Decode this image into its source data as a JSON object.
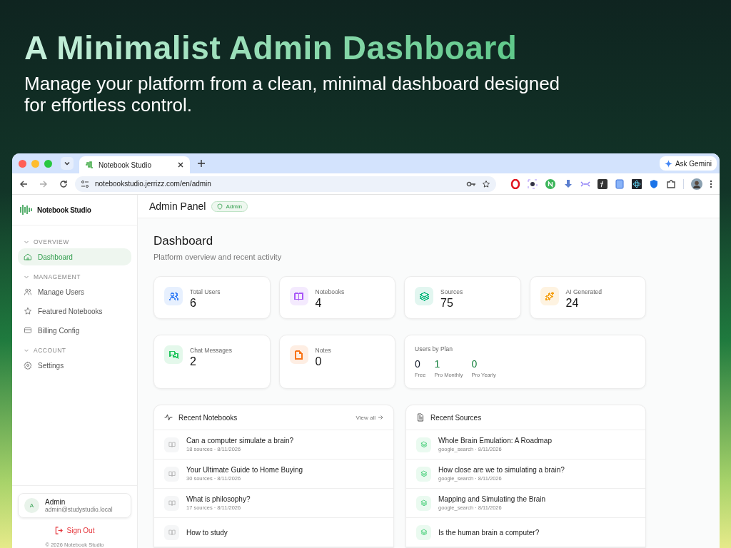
{
  "promo": {
    "headline": "A Minimalist Admin Dashboard",
    "subheadline": "Manage your platform from a clean, minimal dashboard designed for effortless control."
  },
  "browser": {
    "tab_title": "Notebook Studio",
    "url": "notebookstudio.jerrizz.com/en/admin",
    "ask_button": "Ask Gemini"
  },
  "sidebar": {
    "brand": "Notebook Studio",
    "sections": [
      {
        "title": "OVERVIEW",
        "expanded": true,
        "items": [
          {
            "label": "Dashboard",
            "kind": "home",
            "selected": true
          }
        ]
      },
      {
        "title": "MANAGEMENT",
        "expanded": true,
        "items": [
          {
            "label": "Manage Users",
            "kind": "users",
            "selected": false
          },
          {
            "label": "Featured Notebooks",
            "kind": "star",
            "selected": false
          },
          {
            "label": "Billing Config",
            "kind": "card",
            "selected": false
          }
        ]
      },
      {
        "title": "ACCOUNT",
        "expanded": true,
        "items": [
          {
            "label": "Settings",
            "kind": "gear",
            "selected": false
          }
        ]
      }
    ],
    "user": {
      "initial": "A",
      "name": "Admin",
      "email": "admin@studystudio.local"
    },
    "sign_out": "Sign Out",
    "footer": "© 2026 Notebook Studio"
  },
  "header": {
    "title": "Admin Panel",
    "badge": "Admin"
  },
  "dashboard": {
    "title": "Dashboard",
    "subtitle": "Platform overview and recent activity",
    "stats": [
      {
        "label": "Total Users",
        "value": "6",
        "kind": "users",
        "color": "#3b82f6"
      },
      {
        "label": "Notebooks",
        "value": "4",
        "kind": "book",
        "color": "#a855f7"
      },
      {
        "label": "Sources",
        "value": "75",
        "kind": "layers",
        "color": "#10b981"
      },
      {
        "label": "AI Generated",
        "value": "24",
        "kind": "sparkle",
        "color": "#f59e0b"
      },
      {
        "label": "Chat Messages",
        "value": "2",
        "kind": "chat",
        "color": "#22c55e"
      },
      {
        "label": "Notes",
        "value": "0",
        "kind": "note",
        "color": "#f97316"
      }
    ],
    "plans": {
      "title": "Users by Plan",
      "items": [
        {
          "value": "0",
          "label": "Free",
          "color": "#111827"
        },
        {
          "value": "1",
          "label": "Pro Monthly",
          "color": "#15803d"
        },
        {
          "value": "0",
          "label": "Pro Yearly",
          "color": "#15803d"
        }
      ]
    }
  },
  "panels": [
    {
      "title": "Recent Notebooks",
      "kind": "notebooks",
      "link": "View all",
      "items": [
        {
          "title": "Can a computer simulate a brain?",
          "meta": "18 sources · 8/11/2026"
        },
        {
          "title": "Your Ultimate Guide to Home Buying",
          "meta": "30 sources · 8/11/2026"
        },
        {
          "title": "What is philosophy?",
          "meta": "17 sources · 8/11/2026"
        },
        {
          "title": "How to study"
        }
      ]
    },
    {
      "title": "Recent Sources",
      "kind": "sources",
      "items": [
        {
          "title": "Whole Brain Emulation: A Roadmap",
          "meta": "google_search · 8/11/2026"
        },
        {
          "title": "How close are we to simulating a brain?",
          "meta": "google_search · 8/11/2026"
        },
        {
          "title": "Mapping and Simulating the Brain",
          "meta": "google_search · 8/11/2026"
        },
        {
          "title": "Is the human brain a computer?"
        }
      ]
    }
  ]
}
